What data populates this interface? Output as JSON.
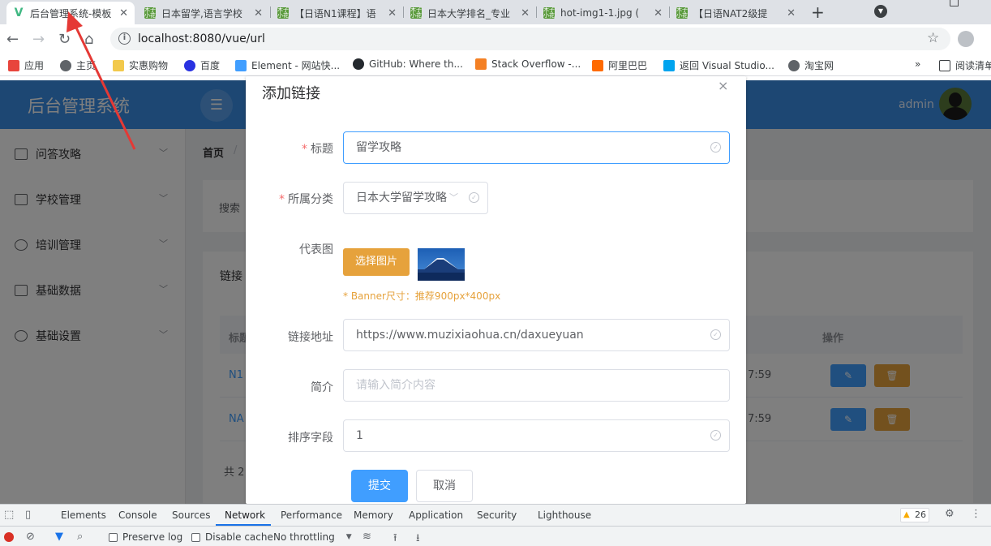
{
  "browser": {
    "tabs": [
      {
        "title": "后台管理系统-模板",
        "icon": "vue-logo-icon",
        "active": true
      },
      {
        "title": "日本留学,语言学校",
        "icon": "muzi-favicon-icon"
      },
      {
        "title": "【日语N1课程】语",
        "icon": "muzi-favicon-icon"
      },
      {
        "title": "日本大学排名_专业",
        "icon": "muzi-favicon-icon"
      },
      {
        "title": "hot-img1-1.jpg (",
        "icon": "muzi-favicon-icon"
      },
      {
        "title": "【日语NAT2级提",
        "icon": "muzi-favicon-icon"
      }
    ],
    "url": "localhost:8080/vue/url",
    "bookmarks": [
      {
        "label": "应用",
        "color": "#e8453c"
      },
      {
        "label": "主页",
        "color": "#5f6368"
      },
      {
        "label": "实惠购物",
        "color": "#f2c94c"
      },
      {
        "label": "百度",
        "color": "#2932e1"
      },
      {
        "label": "Element - 网站快...",
        "color": "#409eff"
      },
      {
        "label": "GitHub: Where th...",
        "color": "#24292e"
      },
      {
        "label": "Stack Overflow -...",
        "color": "#f48024"
      },
      {
        "label": "阿里巴巴",
        "color": "#ff6a00"
      },
      {
        "label": "返回 Visual Studio...",
        "color": "#00a4ef"
      },
      {
        "label": "淘宝网",
        "color": "#5f6368"
      }
    ],
    "bookmarks_more": "»",
    "reading_list": "阅读清单"
  },
  "app": {
    "logo": "后台管理系统",
    "user": "admin",
    "menu": [
      {
        "label": "问答攻略"
      },
      {
        "label": "学校管理"
      },
      {
        "label": "培训管理"
      },
      {
        "label": "基础数据"
      },
      {
        "label": "基础设置"
      }
    ],
    "breadcrumb": {
      "home": "首页",
      "sep": "/"
    },
    "search_label": "搜索",
    "list_title": "链接",
    "table": {
      "col_title": "标题",
      "col_op": "操作",
      "rows": [
        {
          "title": "N1",
          "time": "7:59"
        },
        {
          "title": "NA",
          "time": "7:59"
        }
      ]
    },
    "total": "共 2"
  },
  "dialog": {
    "title": "添加链接",
    "close": "×",
    "fields": {
      "title_label": "标题",
      "title_value": "留学攻略",
      "category_label": "所属分类",
      "category_value": "日本大学留学攻略",
      "image_label": "代表图",
      "pick_image": "选择图片",
      "banner_hint": "* Banner尺寸：推荐900px*400px",
      "url_label": "链接地址",
      "url_value": "https://www.muzixiaohua.cn/daxueyuan",
      "intro_label": "简介",
      "intro_placeholder": "请输入简介内容",
      "sort_label": "排序字段",
      "sort_value": "1"
    },
    "submit": "提交",
    "cancel": "取消"
  },
  "devtools": {
    "tabs": [
      "Elements",
      "Console",
      "Sources",
      "Network",
      "Performance",
      "Memory",
      "Application",
      "Security",
      "Lighthouse"
    ],
    "active_tab": "Network",
    "warnings": "26",
    "preserve_log": "Preserve log",
    "disable_cache": "Disable cache",
    "throttling": "No throttling"
  }
}
